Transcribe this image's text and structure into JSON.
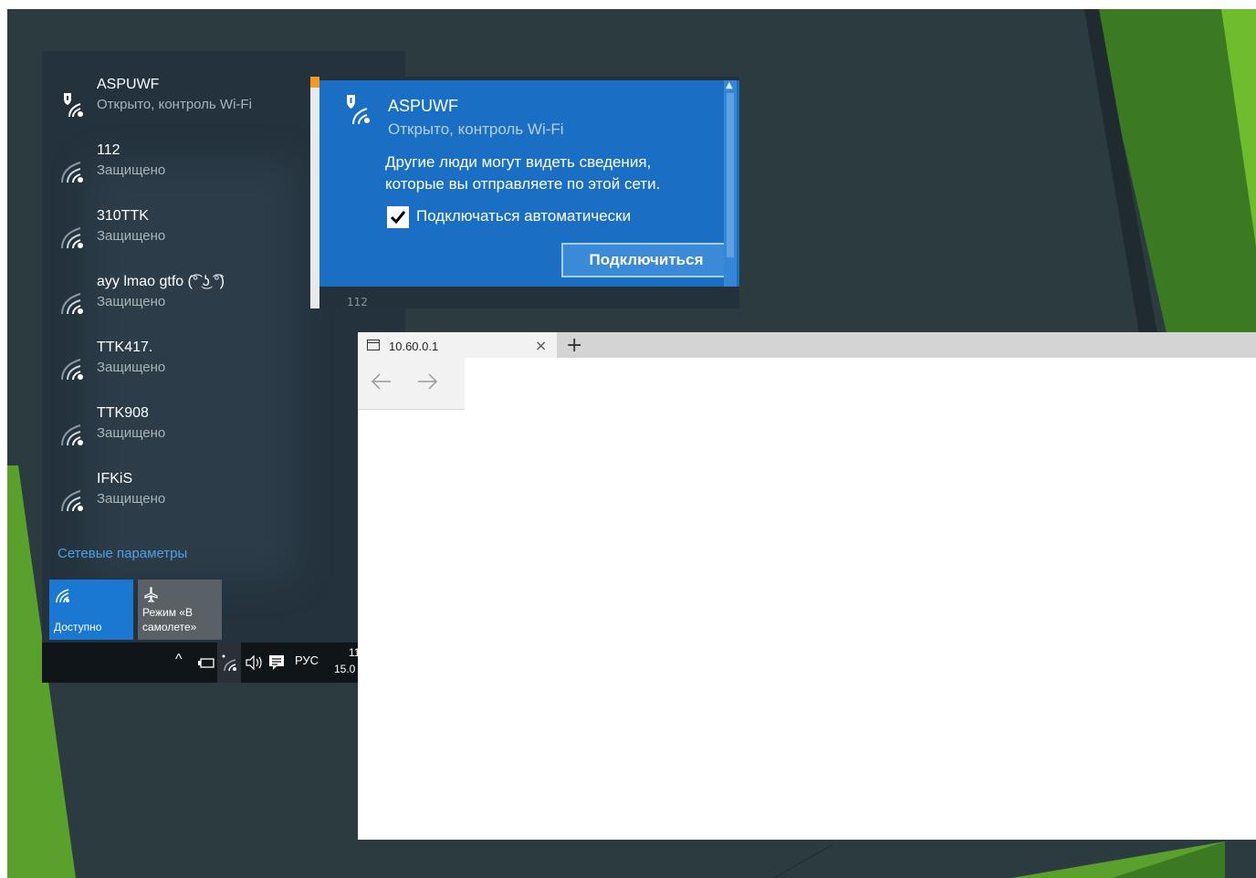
{
  "networks": [
    {
      "ssid": "ASPUWF",
      "status": "Открыто, контроль Wi-Fi",
      "secured": false
    },
    {
      "ssid": "112",
      "status": "Защищено",
      "secured": true
    },
    {
      "ssid": "310TTK",
      "status": "Защищено",
      "secured": true
    },
    {
      "ssid": "ayy lmao gtfo (͡° ͜ʖ ͡°)",
      "status": "Защищено",
      "secured": true
    },
    {
      "ssid": "TTK417.",
      "status": "Защищено",
      "secured": true
    },
    {
      "ssid": "TTK908",
      "status": "Защищено",
      "secured": true
    },
    {
      "ssid": "IFKiS",
      "status": "Защищено",
      "secured": true
    }
  ],
  "network_settings_link": "Сетевые параметры",
  "quick_actions": {
    "wifi_tile": "Доступно",
    "airplane_tile": "Режим «В самолете»"
  },
  "taskbar": {
    "language": "РУС",
    "time": "11",
    "date": "15.0"
  },
  "popup": {
    "ssid": "ASPUWF",
    "status": "Открыто, контроль Wi-Fi",
    "description": "Другие люди могут видеть сведения, которые вы отправляете по этой сети.",
    "auto_connect_label": "Подключаться автоматически",
    "auto_connect_checked": true,
    "connect_button": "Подключиться",
    "next_item_partial": "112"
  },
  "browser": {
    "tab_title": "10.60.0.1",
    "close_symbol": "×",
    "new_tab_symbol": "+",
    "back_symbol": "←",
    "forward_symbol": "→"
  },
  "colors": {
    "slide_bg": "#2c3b40",
    "accent_green": "#5aa02c",
    "popup_blue": "#1a6fc4",
    "link_blue": "#4ea1e8"
  }
}
